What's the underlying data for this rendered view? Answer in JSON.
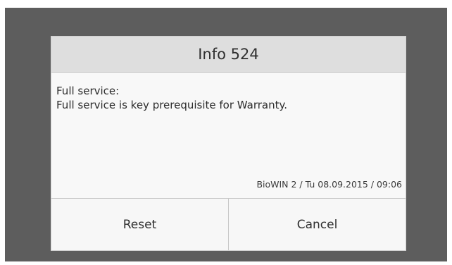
{
  "dialog": {
    "title": "Info 524",
    "message_line1": "Full service:",
    "message_line2": "Full service is key prerequisite for Warranty.",
    "footer_info": "BioWIN 2 / Tu 08.09.2015 / 09:06"
  },
  "buttons": {
    "reset_label": "Reset",
    "cancel_label": "Cancel"
  },
  "colors": {
    "background": "#5d5d5d",
    "header": "#dedede",
    "body": "#f8f8f8"
  }
}
